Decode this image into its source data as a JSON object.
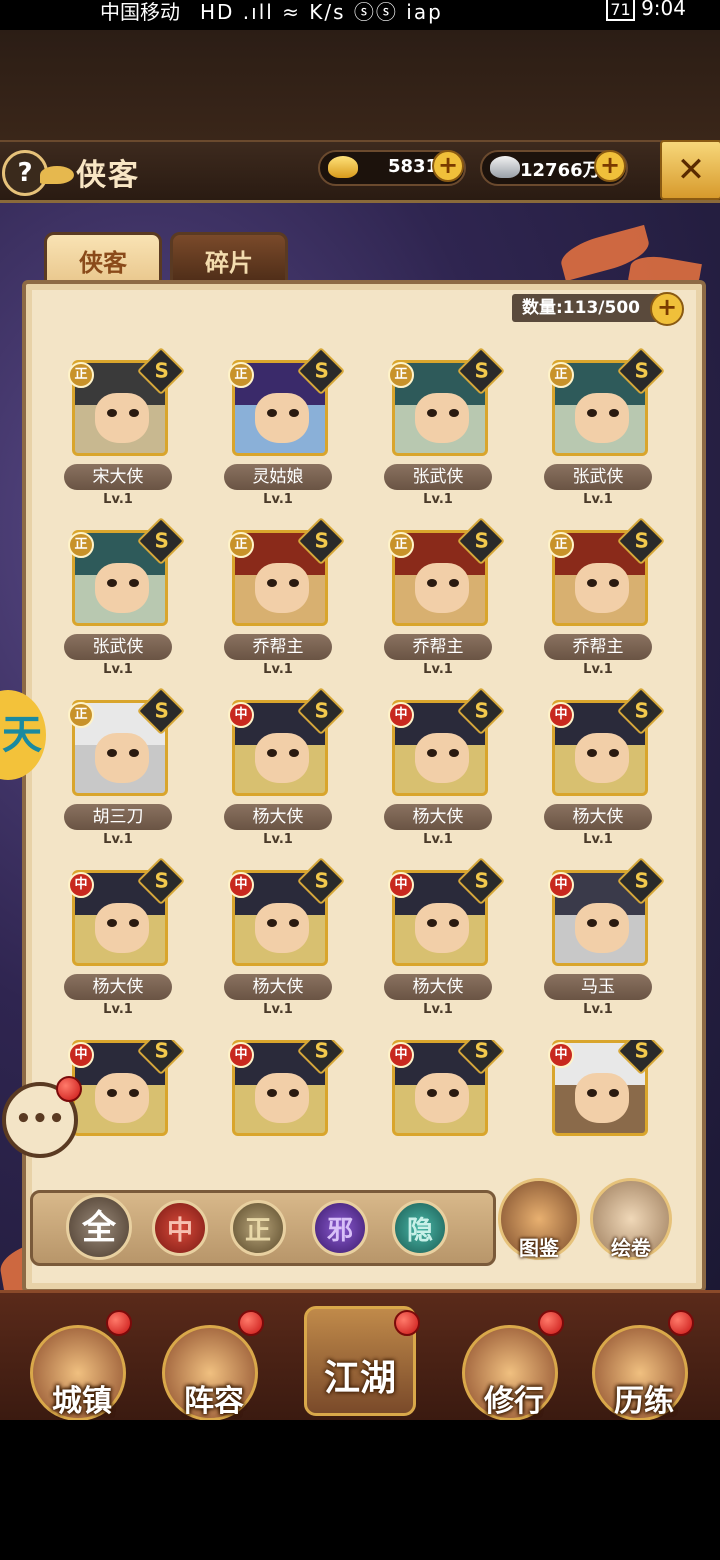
{
  "statusbar": {
    "carrier": "中国移动",
    "signal_glyphs": "HD .ıll ≈ K/s ⓢⓢ iap",
    "battery": "71",
    "time": "9:04"
  },
  "header": {
    "title": "侠客",
    "help": "?",
    "gold": "5831",
    "silver": "12766万",
    "close": "✕"
  },
  "tabs": [
    {
      "label": "侠客"
    },
    {
      "label": "碎片"
    }
  ],
  "count": "数量:113/500",
  "heroes": [
    {
      "name": "宋大侠",
      "lv": "Lv.1",
      "faction": "正"
    },
    {
      "name": "灵姑娘",
      "lv": "Lv.1",
      "faction": "正"
    },
    {
      "name": "张武侠",
      "lv": "Lv.1",
      "faction": "正"
    },
    {
      "name": "张武侠",
      "lv": "Lv.1",
      "faction": "正"
    },
    {
      "name": "张武侠",
      "lv": "Lv.1",
      "faction": "正"
    },
    {
      "name": "乔帮主",
      "lv": "Lv.1",
      "faction": "正"
    },
    {
      "name": "乔帮主",
      "lv": "Lv.1",
      "faction": "正"
    },
    {
      "name": "乔帮主",
      "lv": "Lv.1",
      "faction": "正"
    },
    {
      "name": "胡三刀",
      "lv": "Lv.1",
      "faction": "正"
    },
    {
      "name": "杨大侠",
      "lv": "Lv.1",
      "faction": "中"
    },
    {
      "name": "杨大侠",
      "lv": "Lv.1",
      "faction": "中"
    },
    {
      "name": "杨大侠",
      "lv": "Lv.1",
      "faction": "中"
    },
    {
      "name": "杨大侠",
      "lv": "Lv.1",
      "faction": "中"
    },
    {
      "name": "杨大侠",
      "lv": "Lv.1",
      "faction": "中"
    },
    {
      "name": "杨大侠",
      "lv": "Lv.1",
      "faction": "中"
    },
    {
      "name": "马玉",
      "lv": "Lv.1",
      "faction": "中"
    },
    {
      "name": "",
      "lv": "",
      "faction": "中"
    },
    {
      "name": "",
      "lv": "",
      "faction": "中"
    },
    {
      "name": "",
      "lv": "",
      "faction": "中"
    },
    {
      "name": "",
      "lv": "",
      "faction": "中"
    }
  ],
  "badge": "S",
  "filters": [
    {
      "label": "全"
    },
    {
      "label": "中"
    },
    {
      "label": "正"
    },
    {
      "label": "邪"
    },
    {
      "label": "隐"
    }
  ],
  "side_buttons": [
    {
      "label": "图鉴"
    },
    {
      "label": "绘卷"
    }
  ],
  "chat": "•••",
  "side_tag": "天",
  "nav": [
    {
      "label": "城镇"
    },
    {
      "label": "阵容"
    },
    {
      "label": "江湖"
    },
    {
      "label": "修行"
    },
    {
      "label": "历练"
    }
  ],
  "colors": {
    "accent": "#f0c03a",
    "zheng": "#c8922a",
    "zhong": "#c8281e",
    "xie": "#6a3aa8",
    "yin": "#2a8a7a"
  }
}
